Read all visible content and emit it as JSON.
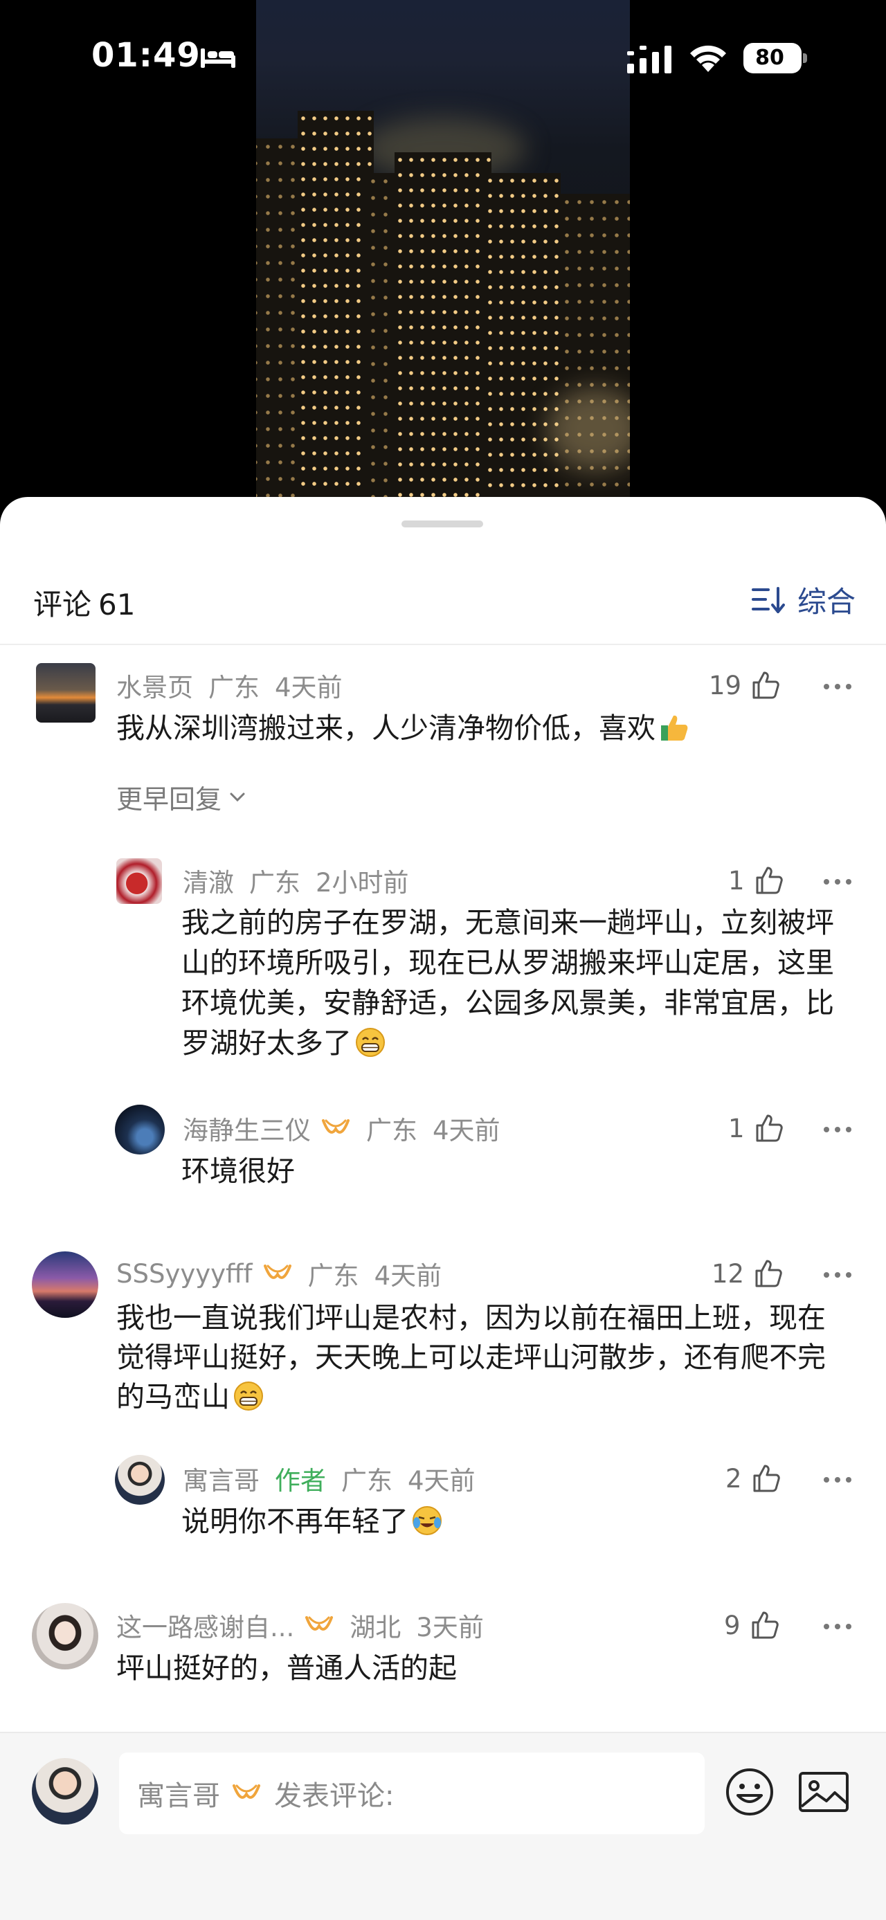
{
  "status_bar": {
    "time": "01:49",
    "battery": "80"
  },
  "icons": {
    "status": [
      "bed-icon",
      "signal-icon",
      "wifi-icon",
      "battery-icon"
    ],
    "comment_actions": [
      "thumb-up-icon",
      "more-icon"
    ],
    "input_tools": [
      "emoji-icon",
      "image-icon"
    ],
    "sort": "sort-icon",
    "badge": "vip-badge-icon"
  },
  "colors": {
    "sort_accent": "#2b4a8f",
    "author_tag": "#3fae5b",
    "vip_badge": "#f0a53c"
  },
  "header": {
    "title": "评论",
    "count": "61",
    "sort_label": "综合"
  },
  "comments": [
    {
      "user": "水景页",
      "location": "广东",
      "time": "4天前",
      "likes": "19",
      "text": "我从深圳湾搬过来，人少清净物价低，喜欢",
      "earlier_replies": "更早回复",
      "replies": [
        {
          "user": "清澈",
          "location": "广东",
          "time": "2小时前",
          "likes": "1",
          "text": "我之前的房子在罗湖，无意间来一趟坪山，立刻被坪山的环境所吸引，现在已从罗湖搬来坪山定居，这里环境优美，安静舒适，公园多风景美，非常宜居，比罗湖好太多了"
        },
        {
          "user": "海静生三仪",
          "location": "广东",
          "time": "4天前",
          "likes": "1",
          "text": "环境很好"
        }
      ]
    },
    {
      "user": "SSSyyyyfff",
      "location": "广东",
      "time": "4天前",
      "likes": "12",
      "text": "我也一直说我们坪山是农村，因为以前在福田上班，现在觉得坪山挺好，天天晚上可以走坪山河散步，还有爬不完的马峦山",
      "replies": [
        {
          "user": "寓言哥",
          "tag": "作者",
          "location": "广东",
          "time": "4天前",
          "likes": "2",
          "text": "说明你不再年轻了"
        }
      ]
    },
    {
      "user": "这一路感谢自...",
      "location": "湖北",
      "time": "3天前",
      "likes": "9",
      "text": "坪山挺好的，普通人活的起"
    }
  ],
  "input": {
    "user": "寓言哥",
    "placeholder": "发表评论:"
  }
}
